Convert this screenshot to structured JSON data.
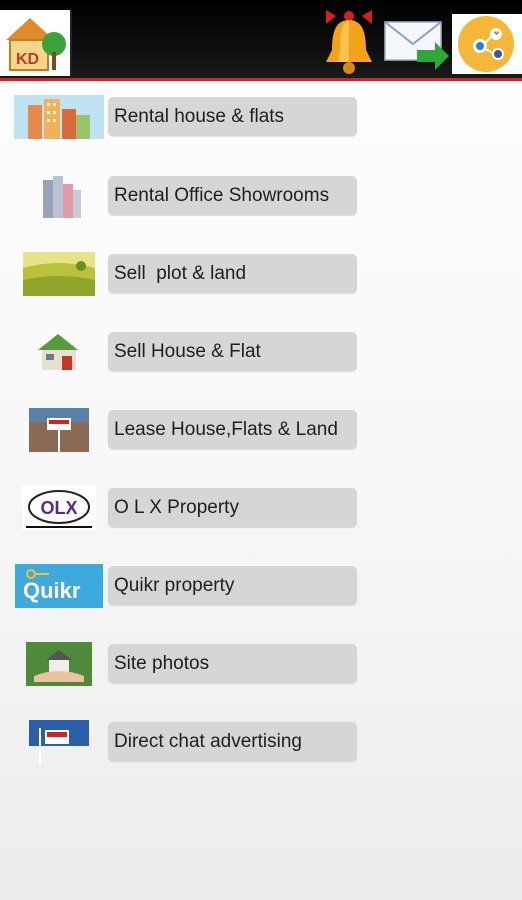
{
  "header": {
    "logo_text": "KD",
    "icons": [
      "app-logo-icon",
      "bell-icon",
      "mail-forward-icon",
      "share-social-icon"
    ]
  },
  "menu": {
    "items": [
      {
        "label": "Rental house & flats",
        "icon": "apartment-buildings-icon"
      },
      {
        "label": "Rental Office Showrooms",
        "icon": "office-towers-icon"
      },
      {
        "label": "Sell  plot & land",
        "icon": "farmland-icon"
      },
      {
        "label": "Sell House & Flat",
        "icon": "house-icon"
      },
      {
        "label": "Lease House,Flats & Land",
        "icon": "sold-sign-icon"
      },
      {
        "label": "O L X Property",
        "icon": "olx-logo-icon"
      },
      {
        "label": "Quikr property",
        "icon": "quikr-logo-icon"
      },
      {
        "label": "Site photos",
        "icon": "house-in-hand-icon"
      },
      {
        "label": "Direct chat advertising",
        "icon": "sale-sign-icon"
      }
    ]
  },
  "brand_logos": {
    "olx": "OLX",
    "quikr": "Quikr"
  },
  "colors": {
    "accent_red": "#e21b1b",
    "pill_bg": "#d6d6d6",
    "topbar": "#000000"
  }
}
